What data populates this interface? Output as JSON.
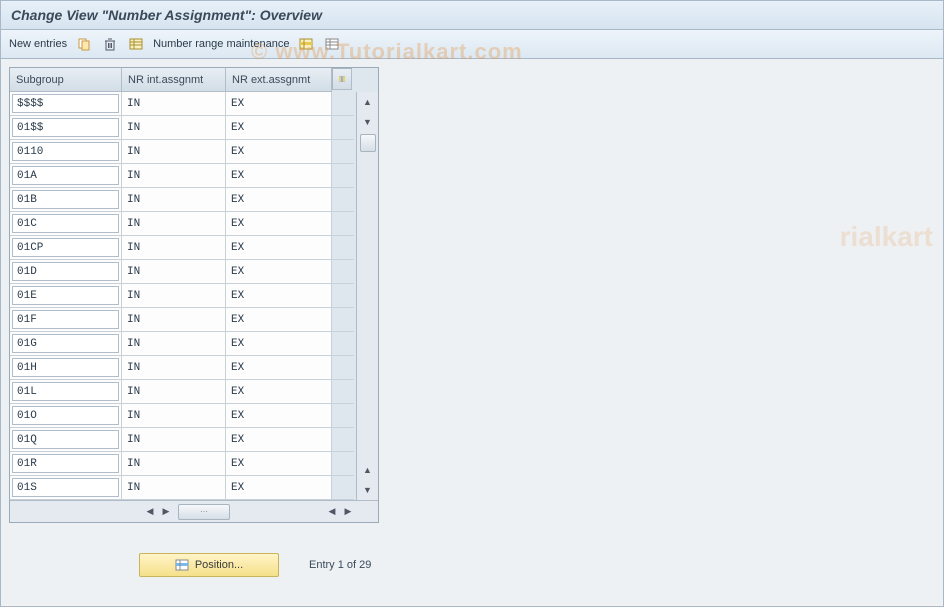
{
  "title": "Change View \"Number Assignment\": Overview",
  "toolbar": {
    "new_entries": "New entries",
    "number_range_maintenance": "Number range maintenance"
  },
  "table": {
    "headers": {
      "subgroup": "Subgroup",
      "nr_int": "NR int.assgnmt",
      "nr_ext": "NR ext.assgnmt"
    },
    "rows": [
      {
        "subgroup": "$$$$",
        "nr_int": "IN",
        "nr_ext": "EX"
      },
      {
        "subgroup": "01$$",
        "nr_int": "IN",
        "nr_ext": "EX"
      },
      {
        "subgroup": "0110",
        "nr_int": "IN",
        "nr_ext": "EX"
      },
      {
        "subgroup": "01A",
        "nr_int": "IN",
        "nr_ext": "EX"
      },
      {
        "subgroup": "01B",
        "nr_int": "IN",
        "nr_ext": "EX"
      },
      {
        "subgroup": "01C",
        "nr_int": "IN",
        "nr_ext": "EX"
      },
      {
        "subgroup": "01CP",
        "nr_int": "IN",
        "nr_ext": "EX"
      },
      {
        "subgroup": "01D",
        "nr_int": "IN",
        "nr_ext": "EX"
      },
      {
        "subgroup": "01E",
        "nr_int": "IN",
        "nr_ext": "EX"
      },
      {
        "subgroup": "01F",
        "nr_int": "IN",
        "nr_ext": "EX"
      },
      {
        "subgroup": "01G",
        "nr_int": "IN",
        "nr_ext": "EX"
      },
      {
        "subgroup": "01H",
        "nr_int": "IN",
        "nr_ext": "EX"
      },
      {
        "subgroup": "01L",
        "nr_int": "IN",
        "nr_ext": "EX"
      },
      {
        "subgroup": "01O",
        "nr_int": "IN",
        "nr_ext": "EX"
      },
      {
        "subgroup": "01Q",
        "nr_int": "IN",
        "nr_ext": "EX"
      },
      {
        "subgroup": "01R",
        "nr_int": "IN",
        "nr_ext": "EX"
      },
      {
        "subgroup": "01S",
        "nr_int": "IN",
        "nr_ext": "EX"
      }
    ]
  },
  "footer": {
    "position_label": "Position...",
    "entry_info": "Entry 1 of 29"
  },
  "watermark": "© www.Tutorialkart.com",
  "watermark2": "rialkart"
}
